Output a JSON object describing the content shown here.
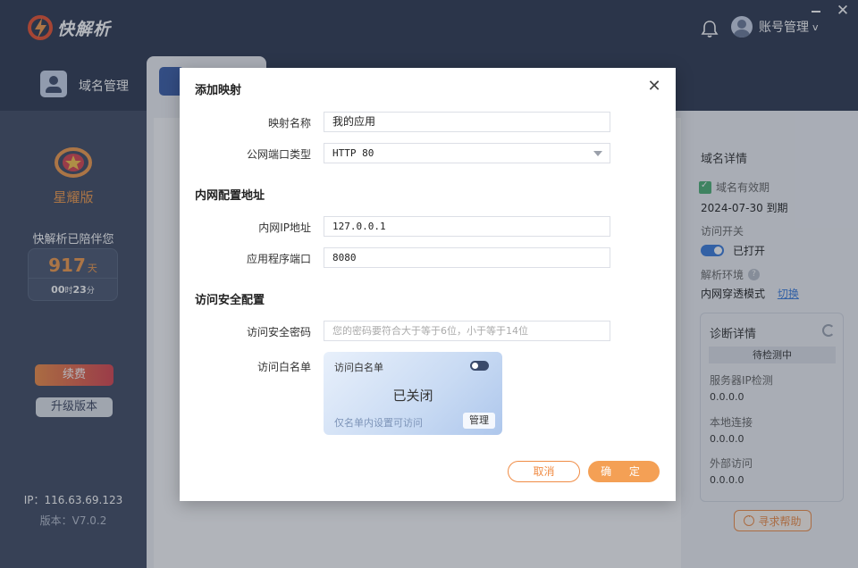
{
  "app": {
    "name": "快解析",
    "account_label": "账号管理",
    "account_caret": "v"
  },
  "tabs": {
    "domain_label": "域名管理"
  },
  "sidebar": {
    "edition": "星耀版",
    "accompany_text": "快解析已陪伴您",
    "days": "917",
    "days_unit": "天",
    "hours": "00",
    "hours_unit": "时",
    "minutes": "23",
    "minutes_unit": "分",
    "renew_label": "续费",
    "upgrade_label": "升级版本",
    "ip_text": "IP：116.63.69.123",
    "version_text": "版本：V7.0.2"
  },
  "detail_panel": {
    "title": "域名详情",
    "validity_label": "域名有效期",
    "validity_date": "2024-07-30 到期",
    "access_switch_label": "访问开关",
    "access_switch_state": "已打开",
    "access_switch_on": true,
    "env_label": "解析环境",
    "env_value": "内网穿透模式",
    "env_switch_link": "切换",
    "diagnosis": {
      "title": "诊断详情",
      "status": "待检测中",
      "items": [
        {
          "label": "服务器IP检测",
          "value": "0.0.0.0"
        },
        {
          "label": "本地连接",
          "value": "0.0.0.0"
        },
        {
          "label": "外部访问",
          "value": "0.0.0.0"
        }
      ]
    },
    "help_button": "寻求帮助"
  },
  "modal": {
    "title": "添加映射",
    "fields": {
      "mapping_name_label": "映射名称",
      "mapping_name_value": "我的应用",
      "public_port_type_label": "公网端口类型",
      "public_port_type_value": "HTTP 80",
      "intranet_section": "内网配置地址",
      "intranet_ip_label": "内网IP地址",
      "intranet_ip_value": "127.0.0.1",
      "app_port_label": "应用程序端口",
      "app_port_value": "8080",
      "security_section": "访问安全配置",
      "password_label": "访问安全密码",
      "password_placeholder": "您的密码要符合大于等于6位，小于等于14位",
      "whitelist_label": "访问白名单"
    },
    "whitelist_card": {
      "title": "访问白名单",
      "state": "已关闭",
      "enabled": false,
      "hint": "仅名单内设置可访问",
      "manage_label": "管理"
    },
    "cancel_label": "取消",
    "ok_label": "确 定"
  },
  "colors": {
    "header_bg": "#2d3851",
    "sidebar_bg": "#404b63",
    "accent_orange": "#f08c45",
    "accent_blue": "#3a7bdc"
  }
}
